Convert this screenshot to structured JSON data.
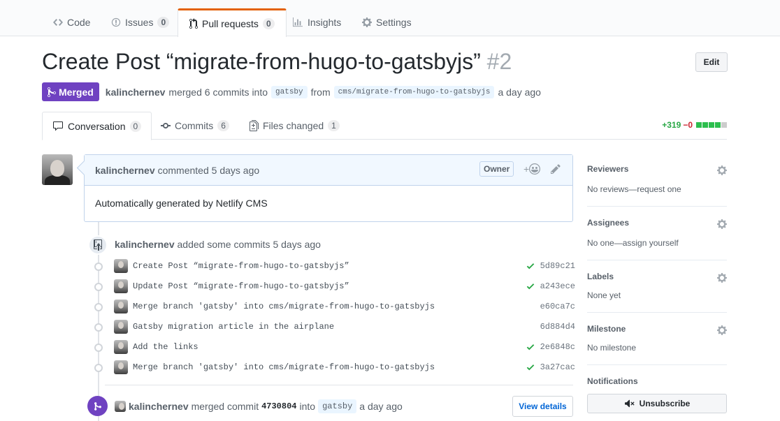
{
  "repo_nav": {
    "tabs": [
      {
        "label": "Code",
        "icon": "code-icon"
      },
      {
        "label": "Issues",
        "count": "0",
        "icon": "issue-icon"
      },
      {
        "label": "Pull requests",
        "count": "0",
        "icon": "pull-request-icon",
        "selected": true
      },
      {
        "label": "Insights",
        "icon": "graph-icon"
      },
      {
        "label": "Settings",
        "icon": "gear-icon"
      }
    ]
  },
  "pr": {
    "title": "Create Post “migrate-from-hugo-to-gatsbyjs”",
    "number": "#2",
    "edit_label": "Edit",
    "state_label": "Merged",
    "author": "kalinchernev",
    "merged_text": "merged 6 commits into",
    "base_branch": "gatsby",
    "from_text": "from",
    "head_branch": "cms/migrate-from-hugo-to-gatsbyjs",
    "time": "a day ago"
  },
  "pr_tabs": [
    {
      "label": "Conversation",
      "count": "0",
      "icon": "comment-icon",
      "selected": true
    },
    {
      "label": "Commits",
      "count": "6",
      "icon": "commit-icon"
    },
    {
      "label": "Files changed",
      "count": "1",
      "icon": "file-diff-icon"
    }
  ],
  "diffstat": {
    "additions": "+319",
    "deletions": "−0",
    "colors": [
      "#2cbe4e",
      "#2cbe4e",
      "#2cbe4e",
      "#2cbe4e",
      "#cccccc"
    ]
  },
  "comment": {
    "author": "kalinchernev",
    "action": "commented 5 days ago",
    "owner_label": "Owner",
    "react_plus": "+",
    "body": "Automatically generated by Netlify CMS"
  },
  "commits_event": {
    "author": "kalinchernev",
    "text": "added some commits 5 days ago",
    "commits": [
      {
        "message": "Create Post “migrate-from-hugo-to-gatsbyjs”",
        "sha": "5d89c21",
        "check": true
      },
      {
        "message": "Update Post “migrate-from-hugo-to-gatsbyjs”",
        "sha": "a243ece",
        "check": true
      },
      {
        "message": "Merge branch 'gatsby' into cms/migrate-from-hugo-to-gatsbyjs",
        "sha": "e60ca7c",
        "check": false
      },
      {
        "message": "Gatsby migration article in the airplane",
        "sha": "6d884d4",
        "check": false
      },
      {
        "message": "Add the links",
        "sha": "2e6848c",
        "check": true
      },
      {
        "message": "Merge branch 'gatsby' into cms/migrate-from-hugo-to-gatsbyjs",
        "sha": "3a27cac",
        "check": true
      }
    ]
  },
  "merge_event": {
    "author": "kalinchernev",
    "text": "merged commit",
    "sha": "4730804",
    "into": "into",
    "branch": "gatsby",
    "time": "a day ago",
    "view_details": "View details"
  },
  "sidebar": {
    "reviewers": {
      "title": "Reviewers",
      "value": "No reviews—request one"
    },
    "assignees": {
      "title": "Assignees",
      "value": "No one—assign yourself"
    },
    "labels": {
      "title": "Labels",
      "value": "None yet"
    },
    "milestone": {
      "title": "Milestone",
      "value": "No milestone"
    },
    "notifications": {
      "title": "Notifications",
      "button": "Unsubscribe"
    }
  }
}
